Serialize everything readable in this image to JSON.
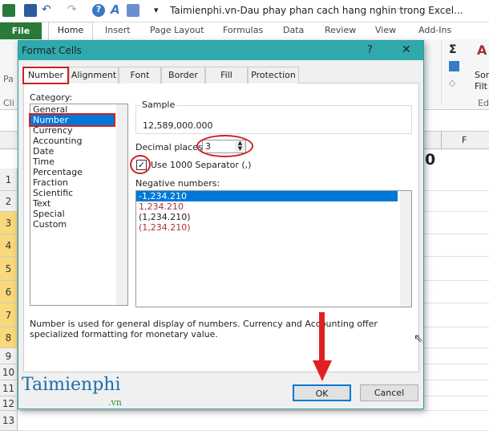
{
  "window": {
    "title": "Taimienphi.vn-Dau phay phan cach hang nghin trong Excel..."
  },
  "ribbon": {
    "tabs": [
      "File",
      "Home",
      "Insert",
      "Page Layout",
      "Formulas",
      "Data",
      "Review",
      "View",
      "Add-Ins"
    ],
    "partial": {
      "paste": "Pa",
      "clipboard": "Cli",
      "sort": "Sor",
      "filter": "Filt",
      "editing": "Ed",
      "t": "t"
    }
  },
  "sheet": {
    "column_f": "F",
    "rows": [
      "1",
      "2",
      "3",
      "4",
      "5",
      "6",
      "7",
      "8",
      "9",
      "10",
      "11",
      "12",
      "13"
    ],
    "cell_fragment": "0"
  },
  "dialog": {
    "title": "Format Cells",
    "help": "?",
    "close": "✕",
    "tabs": [
      "Number",
      "Alignment",
      "Font",
      "Border",
      "Fill",
      "Protection"
    ],
    "active_tab": "Number",
    "category_label": "Category:",
    "categories": [
      "General",
      "Number",
      "Currency",
      "Accounting",
      "Date",
      "Time",
      "Percentage",
      "Fraction",
      "Scientific",
      "Text",
      "Special",
      "Custom"
    ],
    "selected_category": "Number",
    "sample_label": "Sample",
    "sample_value": "12,589,000.000",
    "decimal_label": "Decimal places:",
    "decimal_value": "3",
    "separator_label": "Use 1000 Separator (,)",
    "separator_checked": true,
    "negative_label": "Negative numbers:",
    "negative_options": [
      "-1,234.210",
      "1,234.210",
      "(1,234.210)",
      "(1,234.210)"
    ],
    "description": "Number is used for general display of numbers.  Currency and Accounting offer specialized formatting for monetary value.",
    "ok": "OK",
    "cancel": "Cancel"
  },
  "watermark": {
    "brand": "Taimienphi",
    "suffix": ".vn"
  },
  "colors": {
    "accent": "#30a9ad",
    "selection": "#0078d7",
    "annotation": "#d02020",
    "file_tab": "#2a7a3a",
    "row_highlight": "#f9d97a"
  }
}
